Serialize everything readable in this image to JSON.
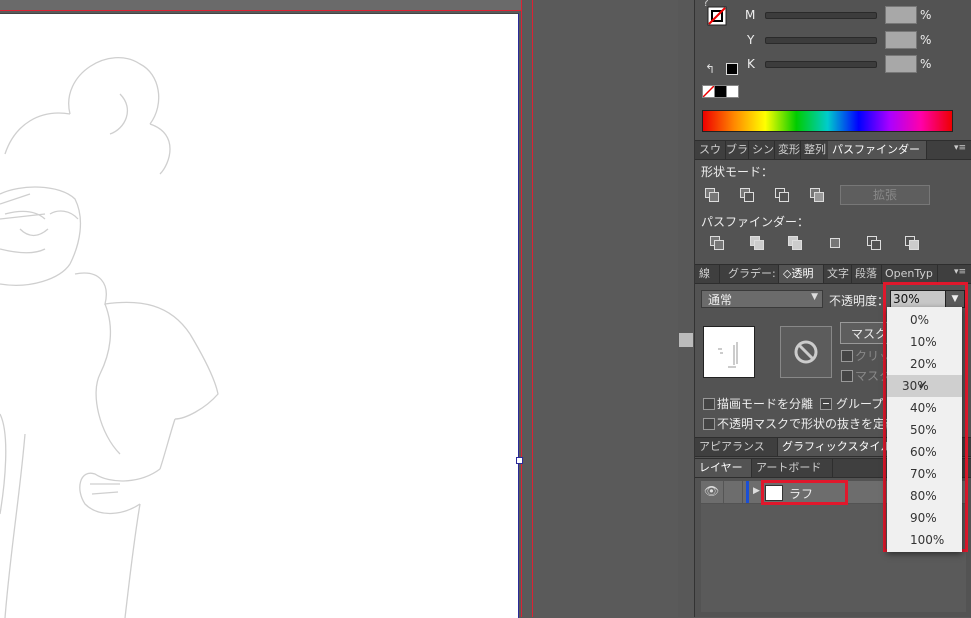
{
  "color_panel": {
    "labels": {
      "m": "M",
      "y": "Y",
      "k": "K"
    },
    "percent": "%",
    "question": "?"
  },
  "pathfinder_tabs": [
    "スウ",
    "ブラ",
    "シン",
    "変形",
    "整列",
    "パスファインダー"
  ],
  "pathfinder": {
    "shape_mode_label": "形状モード：",
    "expand_button": "拡張",
    "pathfinder_label": "パスファインダー："
  },
  "transparency_tabs": [
    "線",
    "グラデー:",
    "◇透明",
    "文字",
    "段落",
    "OpenTyp"
  ],
  "transparency": {
    "blend_mode": "通常",
    "opacity_label": "不透明度：",
    "opacity_value": "30%",
    "mask_button": "マスク",
    "clip_label": "クリッ",
    "invert_label": "マスク",
    "isolate_blending": "描画モードを分離",
    "knockout_group": "グループ",
    "opacity_mask_shape": "不透明マスクで形状の抜きを定義"
  },
  "opacity_options": [
    "0%",
    "10%",
    "20%",
    "30%",
    "40%",
    "50%",
    "60%",
    "70%",
    "80%",
    "90%",
    "100%"
  ],
  "opacity_selected": "30%",
  "appearance_tabs": [
    "アピアランス",
    "グラフィックスタイル"
  ],
  "layers_tabs": [
    "レイヤー",
    "アートボード"
  ],
  "layers": [
    {
      "name": "ラフ"
    }
  ],
  "colors": {
    "highlight": "#e0182c",
    "accent": "#1a4fd6"
  },
  "icons": [
    "fill-stroke-icon",
    "swap-icon",
    "menu-icon",
    "eye-icon",
    "disclosure-triangle-icon",
    "no-mask-icon",
    "checkmark-icon"
  ]
}
